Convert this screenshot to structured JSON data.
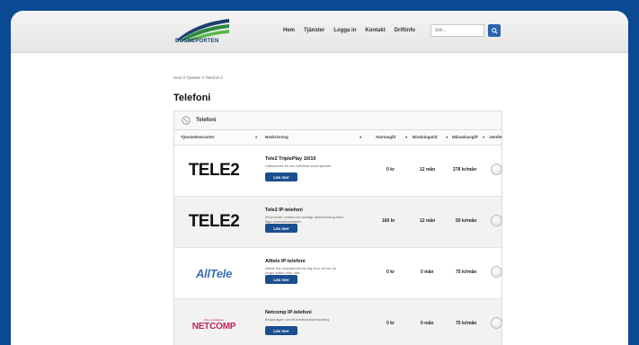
{
  "header": {
    "logo_text": "BOSNEPORTEN",
    "nav": [
      "Hem",
      "Tjänster",
      "Logga in",
      "Kontakt",
      "Driftinfo"
    ],
    "search_placeholder": "Sök...",
    "colors": {
      "accent": "#2a62ad",
      "brand": "#1c3f6e",
      "background": "#0a4a93"
    }
  },
  "breadcrumb": "Hem // Tjänster // Telefoni //",
  "page_title": "Telefoni",
  "panel": {
    "title": "Telefoni",
    "icon": "phone-icon",
    "columns": [
      "Tjänsteleverantör",
      "Beskrivning",
      "Startavgift",
      "Bindningstid",
      "Månadsavgift",
      "Jämför"
    ]
  },
  "rows": [
    {
      "provider": "TELE2",
      "title": "Tele2 TriplePlay 10/10",
      "desc": "Välkommen till oss förbättra stora tjänster",
      "button": "Läs mer",
      "start": "0 kr",
      "binding": "12 mån",
      "monthly": "278 kr/mån"
    },
    {
      "provider": "TELE2",
      "title": "Tele2 IP-telefoni",
      "desc": "Ett prisvärt, enkelt och smidigt abonnemang med låga samtalskostnader.",
      "button": "Läs mer",
      "start": "160 kr",
      "binding": "12 mån",
      "monthly": "50 kr/mån"
    },
    {
      "provider": "AllTele",
      "title": "Alltele IP-telefoni",
      "desc": "Alltele har erbjudandet för dig som vill om du ringer sällan eller ofta.",
      "button": "Läs mer",
      "start": "0 kr",
      "binding": "0 mån",
      "monthly": "75 kr/mån"
    },
    {
      "provider_small": "Fiber av Alltäcke",
      "provider": "NETCOMP",
      "title": "Netcomp IP-telefoni",
      "desc": "Bergsvägen via ett bredbandsanslutning",
      "button": "Läs mer",
      "start": "0 kr",
      "binding": "0 mån",
      "monthly": "75 kr/mån"
    }
  ]
}
